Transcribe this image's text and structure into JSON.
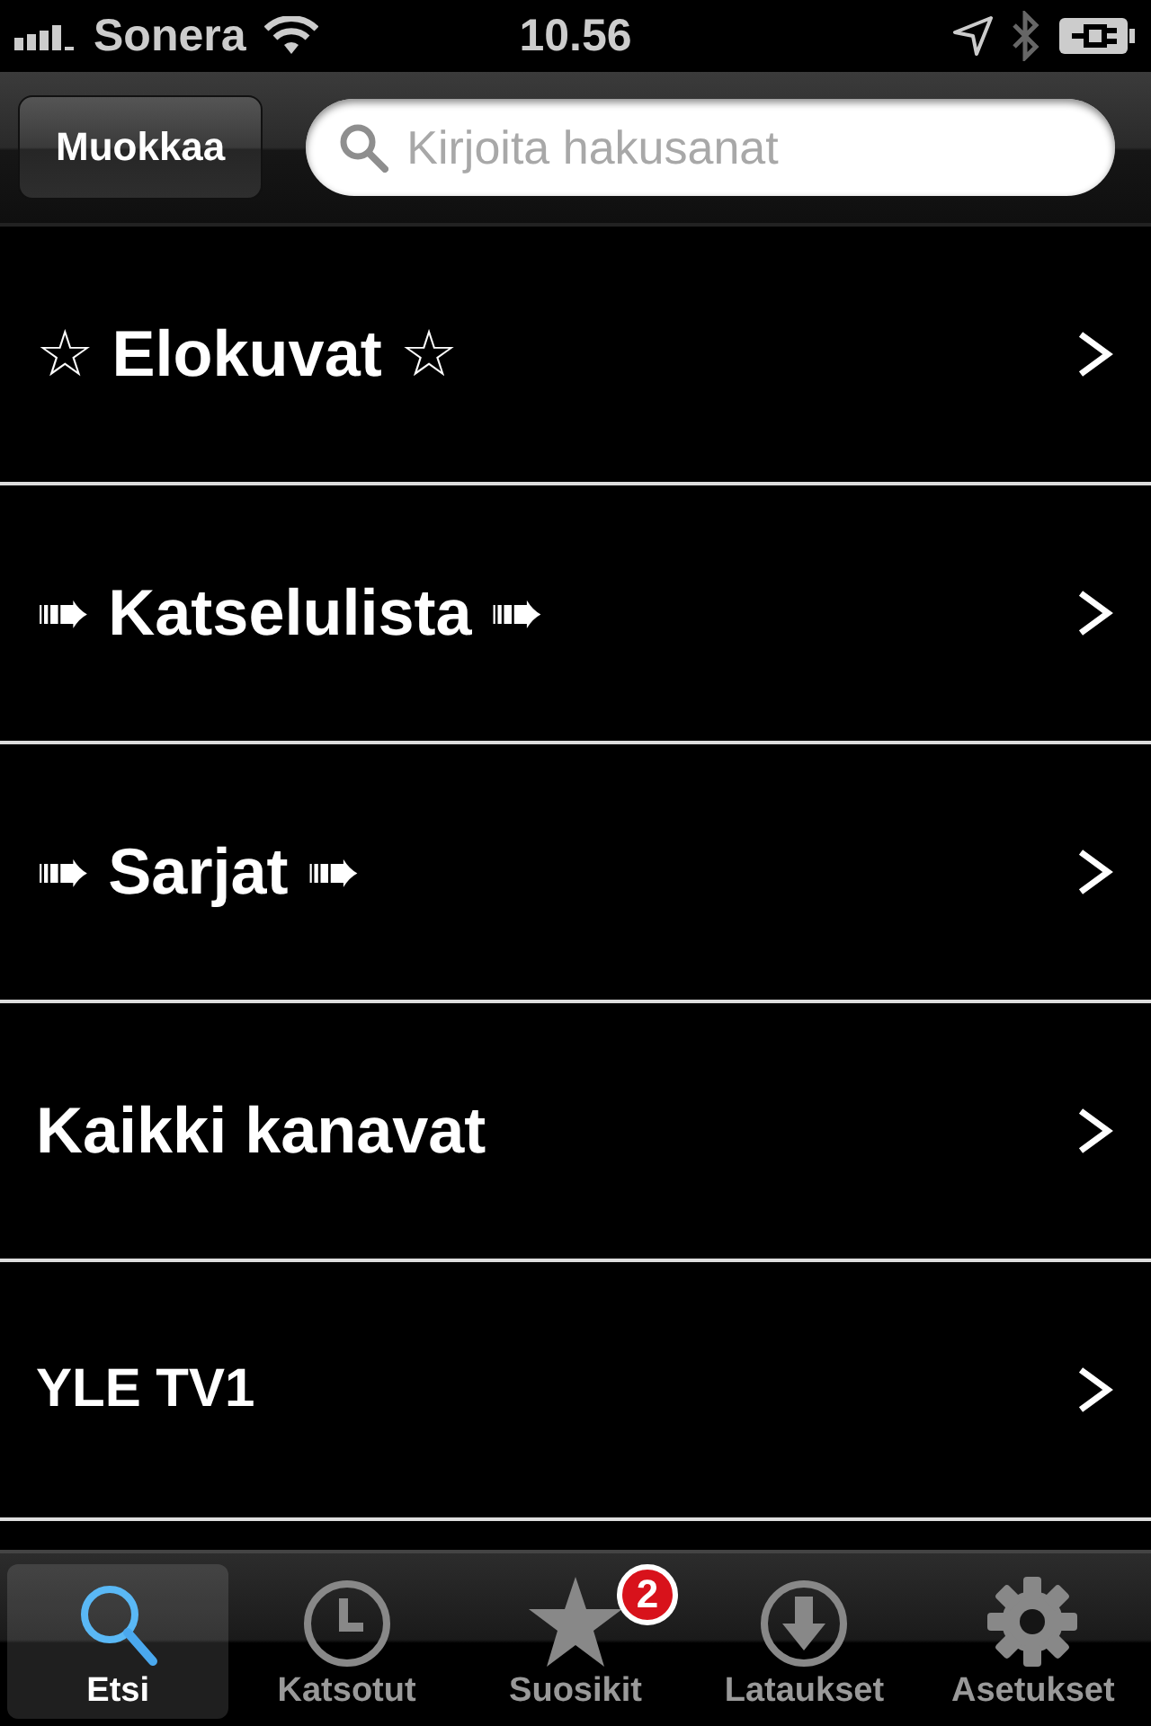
{
  "status_bar": {
    "carrier": "Sonera",
    "time": "10.56"
  },
  "nav_bar": {
    "edit_button": "Muokkaa",
    "search": {
      "placeholder": "Kirjoita hakusanat"
    }
  },
  "list": [
    {
      "label": "☆ Elokuvat ☆",
      "kind": "category"
    },
    {
      "label": "➠ Katselulista ➠",
      "kind": "category"
    },
    {
      "label": "➠ Sarjat ➠",
      "kind": "category"
    },
    {
      "label": "Kaikki kanavat",
      "kind": "category"
    },
    {
      "label": "YLE TV1",
      "kind": "channel"
    }
  ],
  "tab_bar": [
    {
      "label": "Etsi",
      "selected": true
    },
    {
      "label": "Katsotut",
      "selected": false
    },
    {
      "label": "Suosikit",
      "selected": false,
      "badge": "2"
    },
    {
      "label": "Lataukset",
      "selected": false
    },
    {
      "label": "Asetukset",
      "selected": false
    }
  ]
}
